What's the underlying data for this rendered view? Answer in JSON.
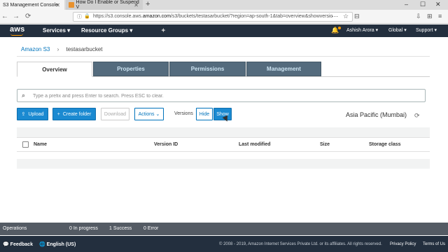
{
  "browser": {
    "tabs": [
      {
        "label": "S3 Management Console",
        "active": true
      },
      {
        "label": "How Do I Enable or Suspend V",
        "active": false
      }
    ],
    "new_tab": "+",
    "window_controls": [
      "–",
      "☐",
      "✕"
    ],
    "nav": {
      "back": "←",
      "forward": "→",
      "reload": "⟳"
    },
    "url_prefix": "https://s3.console.aws.",
    "url_domain": "amazon.com",
    "url_suffix": "/s3/buckets/testasarbucket/?region=ap-south-1&tab=overview&showversio",
    "toolbar_icons": [
      "⋯",
      "☆",
      "⊟",
      "⇩",
      "⊞",
      "≡"
    ]
  },
  "aws_header": {
    "logo": "aws",
    "menu": [
      "Services",
      "Resource Groups"
    ],
    "account": "Ashish Arora",
    "region": "Global",
    "support": "Support",
    "caret": "▾",
    "pin": "✦"
  },
  "breadcrumb": {
    "root": "Amazon S3",
    "sep": "›",
    "current": "testasarbucket"
  },
  "page_tabs": [
    "Overview",
    "Properties",
    "Permissions",
    "Management"
  ],
  "search": {
    "placeholder": "Type a prefix and press Enter to search. Press ESC to clear.",
    "value": ""
  },
  "actions": {
    "upload": "Upload",
    "create_folder": "Create folder",
    "download": "Download",
    "actions": "Actions",
    "versions_label": "Versions",
    "hide": "Hide",
    "show": "Show",
    "region": "Asia Pacific (Mumbai)"
  },
  "table": {
    "columns": [
      "Name",
      "Version ID",
      "Last modified",
      "Size",
      "Storage class"
    ]
  },
  "operations_bar": {
    "label": "Operations",
    "in_progress": "0 In progress",
    "success": "1 Success",
    "error": "0 Error"
  },
  "footer": {
    "feedback": "Feedback",
    "language": "English (US)",
    "copyright": "© 2008 - 2019, Amazon Internet Services Private Ltd. or its affiliates. All rights reserved.",
    "privacy": "Privacy Policy",
    "terms": "Terms of Us"
  },
  "colors": {
    "aws_dark": "#232f3e",
    "aws_orange": "#ff9900",
    "tab_inactive": "#546b7d",
    "button_blue": "#1b8ad1",
    "link_blue": "#0073bb"
  }
}
